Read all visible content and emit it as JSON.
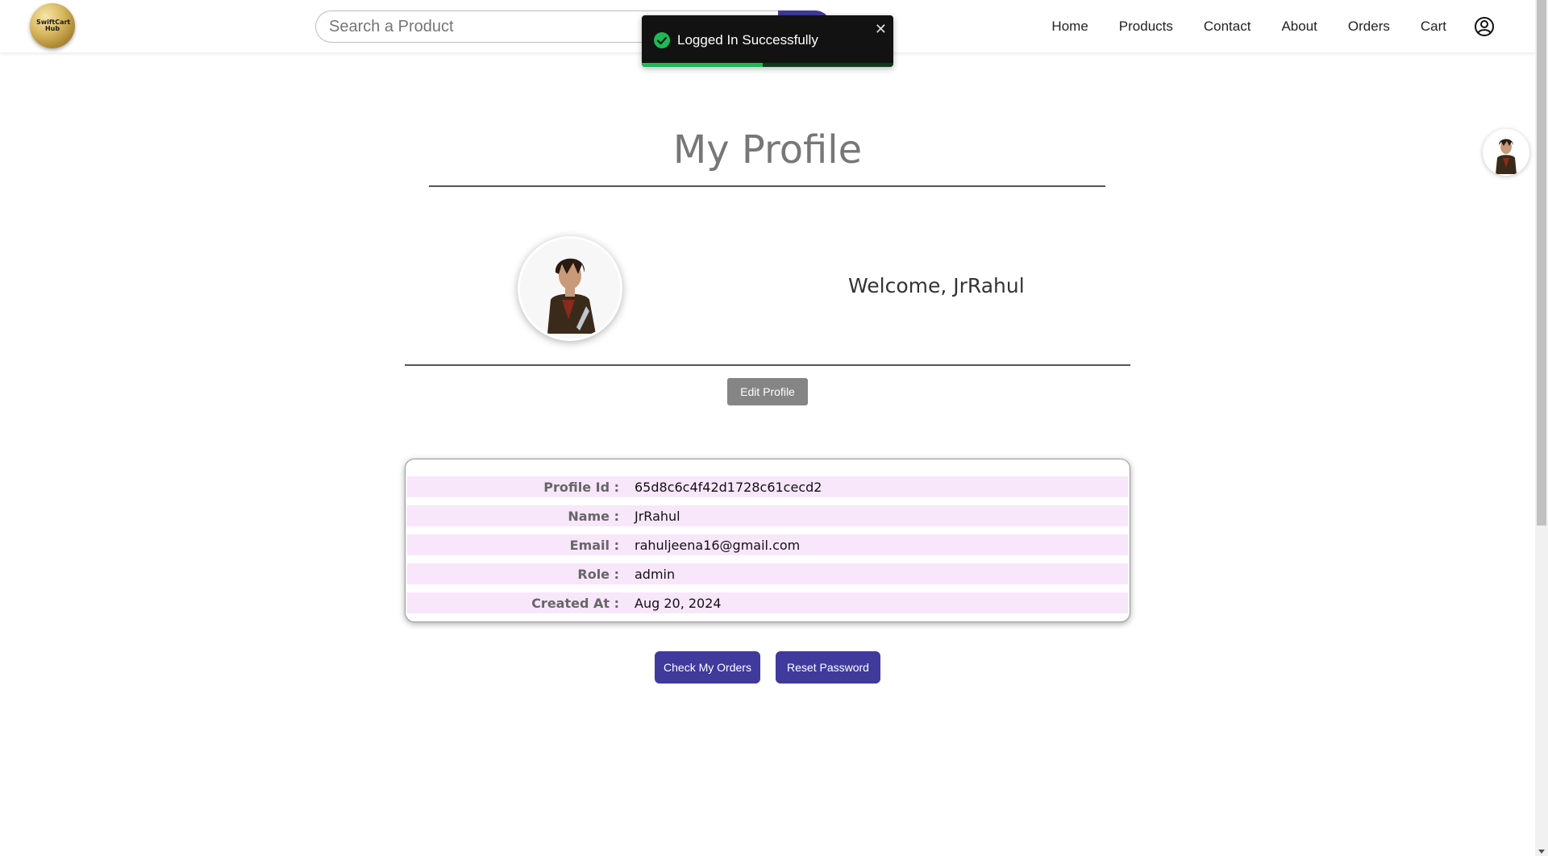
{
  "header": {
    "logo_text": "SwiftCart\nHub",
    "search": {
      "placeholder": "Search a Product",
      "value": ""
    },
    "nav": [
      "Home",
      "Products",
      "Contact",
      "About",
      "Orders",
      "Cart"
    ]
  },
  "toast": {
    "message": "Logged In Successfully",
    "close_glyph": "✕",
    "progress_percent": 48
  },
  "profile": {
    "title": "My Profile",
    "welcome": "Welcome, JrRahul",
    "edit_label": "Edit Profile",
    "fields": [
      {
        "label": "Profile Id :",
        "value": "65d8c6c4f42d1728c61cecd2"
      },
      {
        "label": "Name :",
        "value": "JrRahul"
      },
      {
        "label": "Email :",
        "value": "rahuljeena16@gmail.com"
      },
      {
        "label": "Role :",
        "value": "admin"
      },
      {
        "label": "Created At :",
        "value": "Aug 20, 2024"
      }
    ],
    "actions": {
      "orders_label": "Check My Orders",
      "reset_label": "Reset Password"
    }
  },
  "colors": {
    "accent": "#3f3a9c",
    "toast_bg": "#121212",
    "toast_progress": "#1db954",
    "row_stripe": "#f8e6fb",
    "edit_button": "#858585"
  },
  "icons": {
    "user": "user-circle-icon",
    "success": "check-circle-icon",
    "close": "close-icon"
  }
}
